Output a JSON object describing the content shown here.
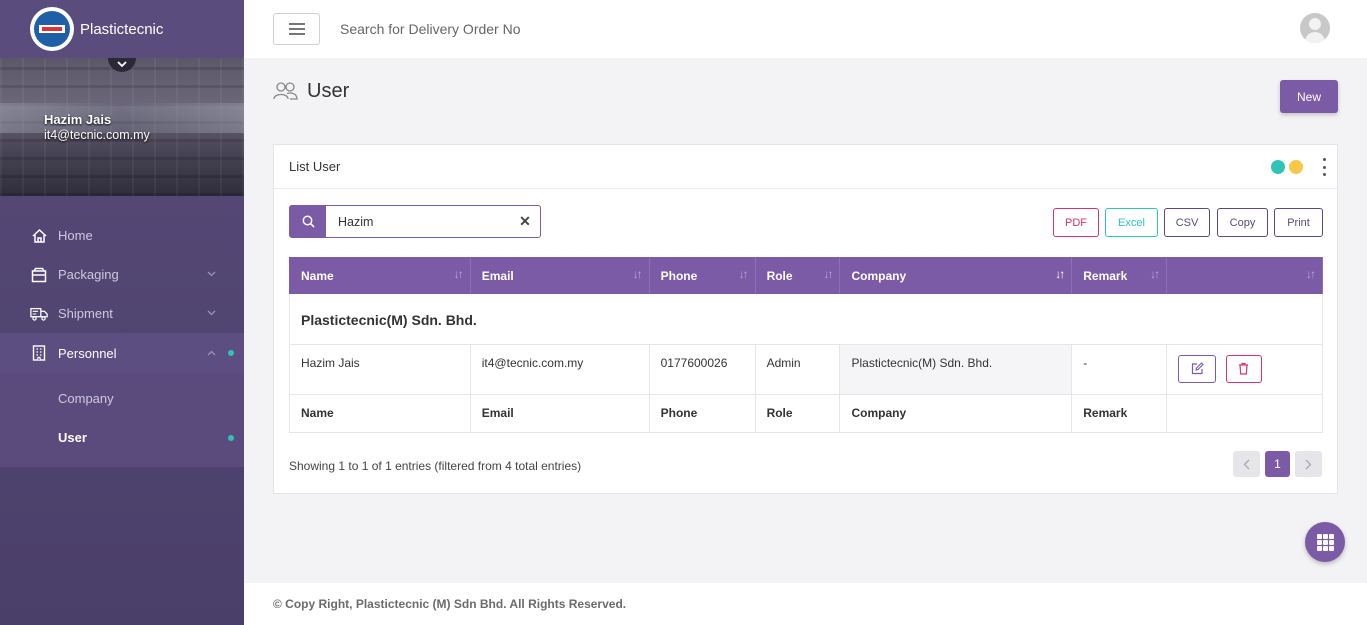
{
  "brand": {
    "name": "Plastictecnic"
  },
  "user": {
    "name": "Hazim Jais",
    "email": "it4@tecnic.com.my"
  },
  "nav": {
    "items": [
      {
        "label": "Home",
        "icon": "home-icon"
      },
      {
        "label": "Packaging",
        "icon": "box-icon"
      },
      {
        "label": "Shipment",
        "icon": "truck-icon"
      },
      {
        "label": "Personnel",
        "icon": "building-icon"
      }
    ],
    "sub": [
      {
        "label": "Company"
      },
      {
        "label": "User"
      }
    ]
  },
  "header": {
    "search_placeholder": "Search for Delivery Order No"
  },
  "page": {
    "title": "User",
    "new_label": "New"
  },
  "card": {
    "title": "List User",
    "search_value": "Hazim",
    "exports": [
      "PDF",
      "Excel",
      "CSV",
      "Copy",
      "Print"
    ]
  },
  "table": {
    "columns": [
      "Name",
      "Email",
      "Phone",
      "Role",
      "Company",
      "Remark",
      ""
    ],
    "group": "Plastictecnic(M) Sdn. Bhd.",
    "rows": [
      {
        "name": "Hazim Jais",
        "email": "it4@tecnic.com.my",
        "phone": "0177600026",
        "role": "Admin",
        "company": "Plastictecnic(M) Sdn. Bhd.",
        "remark": "-"
      }
    ],
    "footer": [
      "Name",
      "Email",
      "Phone",
      "Role",
      "Company",
      "Remark",
      ""
    ],
    "info": "Showing 1 to 1 of 1 entries (filtered from 4 total entries)",
    "current_page": "1"
  },
  "footer": {
    "text": "© Copy Right, Plastictecnic (M) Sdn Bhd. All Rights Reserved."
  },
  "colors": {
    "accent": "#7b5ba6",
    "teal": "#2ec4b6",
    "yellow": "#f7c948",
    "pdf": "#d6336c",
    "excel": "#2ec4b6"
  }
}
